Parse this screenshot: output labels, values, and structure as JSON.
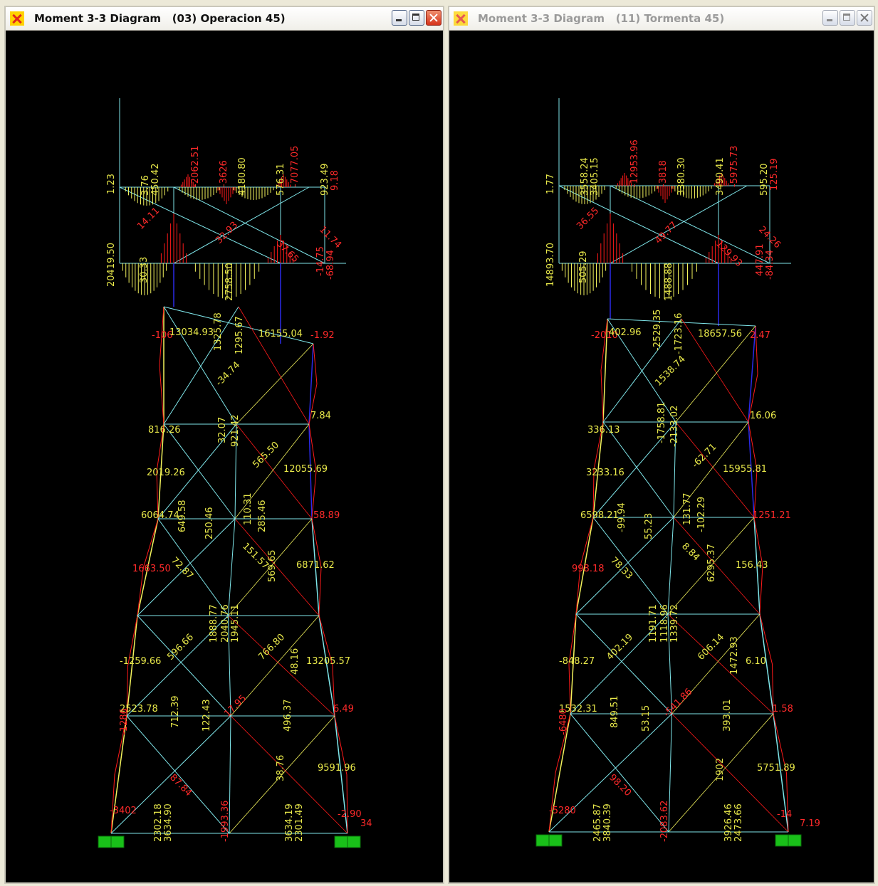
{
  "colors": {
    "member": "#7fe6ea",
    "member_blue": "#2a2ae8",
    "diagram_red": "#ff1a1a",
    "diagram_yellow": "#f2f25c",
    "label_yellow": "#e8e84a",
    "label_red": "#ff2a2a",
    "support": "#19c019"
  },
  "windows": [
    {
      "title": "Moment 3-3 Diagram   (03) Operacion 45)",
      "active": true,
      "labels": {
        "top_left": "1.23",
        "top_a": "3.76",
        "top_b": "450.42",
        "top_c": "-2062.51",
        "top_d": "4180.80",
        "top_e": "-3626",
        "top_f": "576.31",
        "top_g": "-7077.05",
        "top_h": "923.49",
        "top_i": "9.18",
        "top_j": "14.11",
        "top_k": "32.93",
        "top_l": "37.65",
        "top_m": "11.74",
        "mid_a": "20419.50",
        "mid_b": "30.33",
        "mid_c": "2758.50",
        "mid_d": "-14.75",
        "mid_e": "-68.94",
        "up_a": "-106",
        "up_b": "13034.93",
        "up_c": "1325.78",
        "up_d": "1295.67",
        "up_e": "16155.04",
        "up_f": "-1.92",
        "up_g": "-34.74",
        "up_h": "32.07",
        "up_i": "921.42",
        "up_j": "816.26",
        "up_k": "7.84",
        "p1_a": "2019.26",
        "p1_b": "565.50",
        "p1_c": "12055.69",
        "p1_d": "6064.74",
        "p1_e": "649.58",
        "p1_f": "250.46",
        "p1_g": "110.31",
        "p1_h": "285.46",
        "p1_i": "151.57",
        "p1_j": "58.89",
        "p1_k": "1663.50",
        "p1_l": "72.87",
        "p1_m": "569.65",
        "p1_n": "6871.62",
        "p2_a": "1888.77",
        "p2_b": "2040.76",
        "p2_c": "1945.11",
        "p2_d": "-1259.66",
        "p2_e": "596.66",
        "p2_f": "766.80",
        "p2_g": "48.16",
        "p2_h": "13205.57",
        "p3_a": "2523.78",
        "p3_b": "712.39",
        "p3_c": "122.43",
        "p3_d": "17.95",
        "p3_e": "496.37",
        "p3_f": "-1286",
        "p3_g": "6.49",
        "p4_a": "87.84",
        "p4_b": "38.76",
        "p4_c": "9591.96",
        "base_a": "-3402",
        "base_b": "2302.18",
        "base_c": "3634.90",
        "base_d": "-1993.36",
        "base_e": "3634.19",
        "base_f": "2301.49",
        "base_g": "-2.90",
        "base_h": "34"
      }
    },
    {
      "title": "Moment 3-3 Diagram   (11) Tormenta 45)",
      "active": false,
      "labels": {
        "top_left": "1.77",
        "top_a": "3558.24",
        "top_b": "3405.15",
        "top_c": "-12953.96",
        "top_d": "3380.30",
        "top_e": "-3818",
        "top_f": "3490.41",
        "top_g": "-5975.73",
        "top_h": "595.20",
        "top_i": "125.19",
        "top_j": "36.55",
        "top_k": "49.77",
        "top_l": "129.93",
        "top_m": "24.26",
        "mid_a": "14893.70",
        "mid_b": "505.29",
        "mid_c": "1488.88",
        "mid_d": "447.91",
        "mid_e": "-84.34",
        "up_a": "-2010",
        "up_b": "402.96",
        "up_c": "-2529.35",
        "up_d": "-1723.16",
        "up_e": "18657.56",
        "up_f": "2.47",
        "up_g": "1538.74",
        "up_h": "-1758.81",
        "up_i": "-2133.02",
        "up_j": "336.13",
        "up_k": "16.06",
        "p1_a": "3233.16",
        "p1_b": "-62.71",
        "p1_c": "15955.81",
        "p1_d": "6598.21",
        "p1_e": "-99.94",
        "p1_f": "55.23",
        "p1_g": "131.77",
        "p1_h": "-102.29",
        "p1_i": "8.84",
        "p1_j": "1251.21",
        "p1_k": "998.18",
        "p1_l": "78.33",
        "p1_m": "6295.37",
        "p1_n": "156.43",
        "p2_a": "1191.71",
        "p2_b": "1118.96",
        "p2_c": "1339.72",
        "p2_d": "-848.27",
        "p2_e": "402.19",
        "p2_f": "606.14",
        "p2_g": "1472.93",
        "p2_h": "6.10",
        "p3_a": "1532.31",
        "p3_b": "849.51",
        "p3_c": "53.15",
        "p3_d": "-541.86",
        "p3_e": "393.01",
        "p3_f": "-6480",
        "p3_g": "1.58",
        "p4_a": "98.20",
        "p4_b": "1902",
        "p4_c": "5751.89",
        "base_a": "-5280",
        "base_b": "2465.87",
        "base_c": "3840.39",
        "base_d": "-2083.62",
        "base_e": "3926.46",
        "base_f": "2473.66",
        "base_g": "-14",
        "base_h": "7.19"
      }
    }
  ]
}
